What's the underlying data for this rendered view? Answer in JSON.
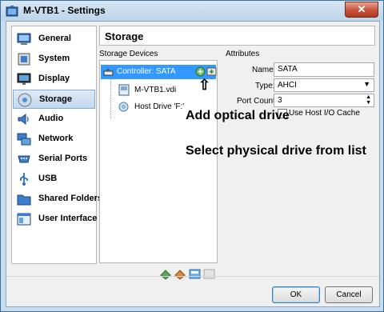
{
  "window": {
    "title": "M-VTB1 - Settings",
    "close_glyph": "✕"
  },
  "sidebar": {
    "items": [
      {
        "label": "General",
        "icon": "general-icon"
      },
      {
        "label": "System",
        "icon": "system-icon"
      },
      {
        "label": "Display",
        "icon": "display-icon"
      },
      {
        "label": "Storage",
        "icon": "storage-icon",
        "selected": true
      },
      {
        "label": "Audio",
        "icon": "audio-icon"
      },
      {
        "label": "Network",
        "icon": "network-icon"
      },
      {
        "label": "Serial Ports",
        "icon": "serial-ports-icon"
      },
      {
        "label": "USB",
        "icon": "usb-icon"
      },
      {
        "label": "Shared Folders",
        "icon": "shared-folders-icon"
      },
      {
        "label": "User Interface",
        "icon": "user-interface-icon"
      }
    ]
  },
  "page": {
    "title": "Storage"
  },
  "storage_devices": {
    "label": "Storage Devices",
    "controller": "Controller: SATA",
    "disk": "M-VTB1.vdi",
    "optical": "Host Drive 'F:'"
  },
  "attributes": {
    "label": "Attributes",
    "name_label": "Name:",
    "name_value": "SATA",
    "type_label": "Type:",
    "type_value": "AHCI",
    "port_count_label": "Port Count:",
    "port_count_value": "3",
    "cache_label": "Use Host I/O Cache",
    "cache_checked": false
  },
  "annotations": {
    "arrow": "⇧",
    "add_optical": "Add optical drive",
    "select_physical": "Select physical drive from list"
  },
  "buttons": {
    "ok": "OK",
    "cancel": "Cancel"
  },
  "colors": {
    "selection": "#3399ff",
    "title_bar": "#c7dcef"
  }
}
